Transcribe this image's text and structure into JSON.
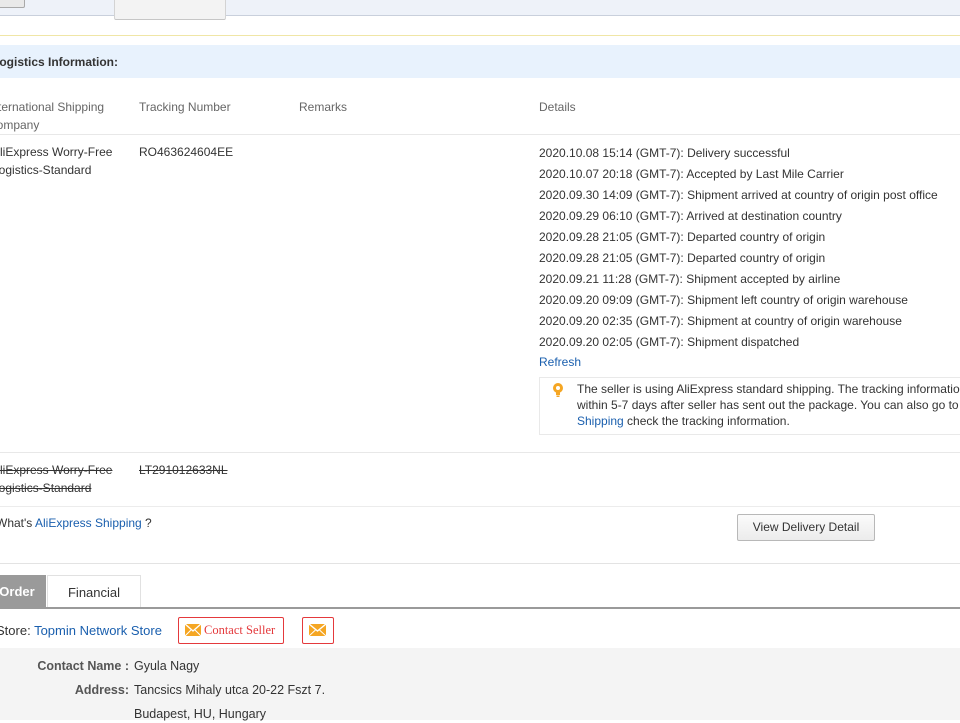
{
  "logistics": {
    "title": "Logistics Information:",
    "columns": {
      "company": [
        "International Shipping",
        "Company"
      ],
      "tracking": "Tracking Number",
      "remarks": "Remarks",
      "details": "Details"
    },
    "shipments": [
      {
        "company": [
          "AliExpress Worry-Free",
          "Logistics-Standard"
        ],
        "tracking_number": "RO463624604EE",
        "remarks": "",
        "events": [
          "2020.10.08 15:14 (GMT-7): Delivery successful",
          "2020.10.07 20:18 (GMT-7): Accepted by Last Mile Carrier",
          "2020.09.30 14:09 (GMT-7): Shipment arrived at country of origin post office",
          "2020.09.29 06:10 (GMT-7): Arrived at destination country",
          "2020.09.28 21:05 (GMT-7): Departed country of origin",
          "2020.09.28 21:05 (GMT-7): Departed country of origin",
          "2020.09.21 11:28 (GMT-7): Shipment accepted by airline",
          "2020.09.20 09:09 (GMT-7): Shipment left country of origin warehouse",
          "2020.09.20 02:35 (GMT-7): Shipment at country of origin warehouse",
          "2020.09.20 02:05 (GMT-7): Shipment dispatched"
        ],
        "refresh_label": "Refresh",
        "notice": {
          "line1": "The seller is using AliExpress standard shipping. The tracking information",
          "line2": "within 5-7 days after seller has sent out the package. You can also go to",
          "link": "Shipping",
          "line3_rest": " check the tracking information."
        }
      },
      {
        "company": [
          "AliExpress Worry-Free",
          "Logistics-Standard"
        ],
        "tracking_number": "LT291012633NL",
        "strikethrough": true
      }
    ],
    "help": {
      "prefix": "What's ",
      "link": "AliExpress Shipping",
      "suffix": " ?"
    },
    "view_delivery_label": "View Delivery Detail"
  },
  "tabs": [
    {
      "label": "Order",
      "active": true
    },
    {
      "label": "Financial",
      "active": false
    }
  ],
  "store": {
    "label": "Store: ",
    "name": "Topmin Network Store",
    "contact_label": "Contact Seller"
  },
  "recipient": {
    "contact_label": "Contact Name :",
    "contact_name": "Gyula Nagy",
    "address_label": "Address:",
    "address_line1": "Tancsics Mihaly utca 20-22 Fszt 7.",
    "address_line2": "Budapest, HU, Hungary"
  },
  "colors": {
    "link": "#1a5fae",
    "accent_red": "#e4393c",
    "header_bg": "#e8f2fd",
    "notice_icon": "#f5a623"
  }
}
